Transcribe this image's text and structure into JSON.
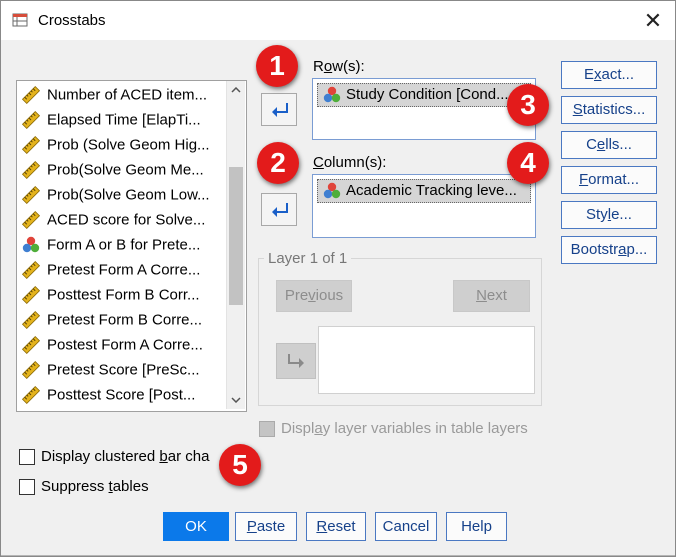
{
  "window": {
    "title": "Crosstabs",
    "close_glyph": "✕"
  },
  "variables": [
    {
      "label": "Number of ACED item...",
      "icon": "ruler-scale-icon"
    },
    {
      "label": "Elapsed Time [ElapTi...",
      "icon": "ruler-scale-icon"
    },
    {
      "label": "Prob (Solve Geom Hig...",
      "icon": "ruler-scale-icon"
    },
    {
      "label": "Prob(Solve Geom Me...",
      "icon": "ruler-scale-icon"
    },
    {
      "label": "Prob(Solve Geom Low...",
      "icon": "ruler-scale-icon"
    },
    {
      "label": "ACED score for Solve...",
      "icon": "ruler-scale-icon"
    },
    {
      "label": "Form A or B for Prete...",
      "icon": "nominal-circles-icon"
    },
    {
      "label": "Pretest Form A Corre...",
      "icon": "ruler-scale-icon"
    },
    {
      "label": "Posttest Form B Corr...",
      "icon": "ruler-scale-icon"
    },
    {
      "label": "Pretest Form B Corre...",
      "icon": "ruler-scale-icon"
    },
    {
      "label": "Postest Form A Corre...",
      "icon": "ruler-scale-icon"
    },
    {
      "label": "Pretest Score [PreSc...",
      "icon": "ruler-scale-icon"
    },
    {
      "label": "Posttest Score [Post...",
      "icon": "ruler-scale-icon"
    }
  ],
  "rows": {
    "label_pre": "R",
    "label_ul": "o",
    "label_post": "w(s):",
    "value": "Study Condition [Cond..."
  },
  "columns": {
    "label_pre": "",
    "label_ul": "C",
    "label_post": "olumn(s):",
    "value": "Academic Tracking leve..."
  },
  "side_buttons": {
    "exact": {
      "pre": "E",
      "ul": "x",
      "post": "act..."
    },
    "statistics": {
      "pre": "",
      "ul": "S",
      "post": "tatistics..."
    },
    "cells": {
      "pre": "C",
      "ul": "e",
      "post": "lls..."
    },
    "format": {
      "pre": "",
      "ul": "F",
      "post": "ormat..."
    },
    "style": {
      "pre": "Sty",
      "ul": "l",
      "post": "e..."
    },
    "bootstrap": {
      "pre": "Bootstr",
      "ul": "a",
      "post": "p..."
    }
  },
  "layer": {
    "title": "Layer 1 of 1",
    "previous": {
      "pre": "Pre",
      "ul": "v",
      "post": "ious"
    },
    "next": {
      "pre": "",
      "ul": "N",
      "post": "ext"
    }
  },
  "checkboxes": {
    "display_layer": {
      "pre": "Displ",
      "ul": "a",
      "post": "y layer variables in table layers",
      "checked": false,
      "enabled": false
    },
    "clustered": {
      "pre": "Display clustered ",
      "ul": "b",
      "post": "ar cha",
      "checked": false
    },
    "suppress": {
      "pre": "Suppress ",
      "ul": "t",
      "post": "ables",
      "checked": false
    }
  },
  "bottom_buttons": {
    "ok": "OK",
    "paste": {
      "pre": "",
      "ul": "P",
      "post": "aste"
    },
    "reset": {
      "pre": "",
      "ul": "R",
      "post": "eset"
    },
    "cancel": "Cancel",
    "help": "Help"
  },
  "badges": [
    "1",
    "2",
    "3",
    "4",
    "5"
  ],
  "colors": {
    "badge": "#e31b1b",
    "ok_button": "#0b79ea",
    "button_border": "#4a78c2",
    "arrow_icon": "#1a5fc8"
  }
}
